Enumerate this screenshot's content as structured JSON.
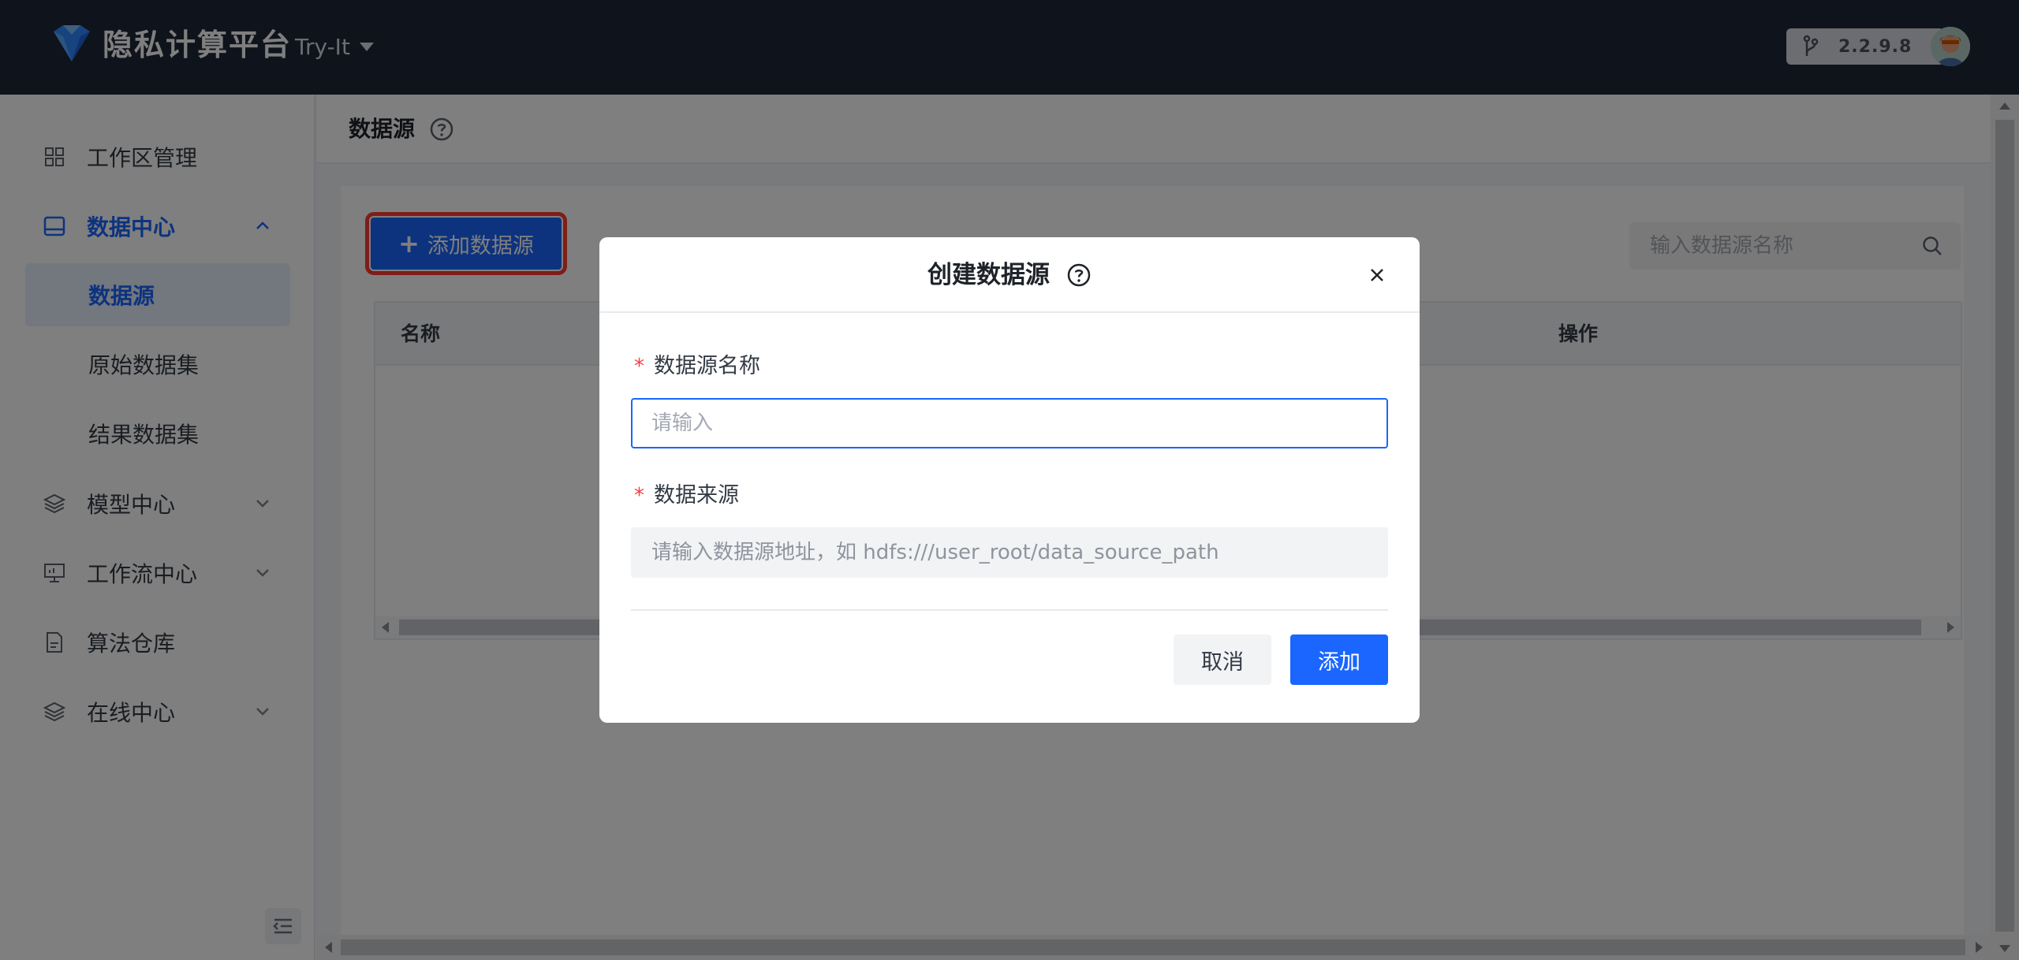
{
  "header": {
    "brand": "隐私计算平台",
    "workspace": "Try-It",
    "version": "2.2.9.8"
  },
  "sidebar": {
    "items": [
      {
        "label": "工作区管理",
        "icon": "grid-icon"
      },
      {
        "label": "数据中心",
        "icon": "database-icon",
        "expanded": true
      },
      {
        "label": "数据源",
        "selected": true
      },
      {
        "label": "原始数据集"
      },
      {
        "label": "结果数据集"
      },
      {
        "label": "模型中心",
        "icon": "layers-icon"
      },
      {
        "label": "工作流中心",
        "icon": "monitor-icon"
      },
      {
        "label": "算法仓库",
        "icon": "document-icon"
      },
      {
        "label": "在线中心",
        "icon": "layers-icon"
      }
    ]
  },
  "page": {
    "title": "数据源",
    "add_button": "添加数据源",
    "search_placeholder": "输入数据源名称",
    "table_headers": {
      "name": "名称",
      "actions": "操作"
    }
  },
  "modal": {
    "title": "创建数据源",
    "name_label": "数据源名称",
    "name_placeholder": "请输入",
    "source_label": "数据来源",
    "source_placeholder": "请输入数据源地址，如 hdfs:///user_root/data_source_path",
    "required_mark": "*",
    "cancel": "取消",
    "submit": "添加"
  },
  "colors": {
    "primary": "#1a66ff",
    "header_bg": "#1f2738",
    "required": "#f53f3f",
    "highlight": "#ff3b30"
  }
}
